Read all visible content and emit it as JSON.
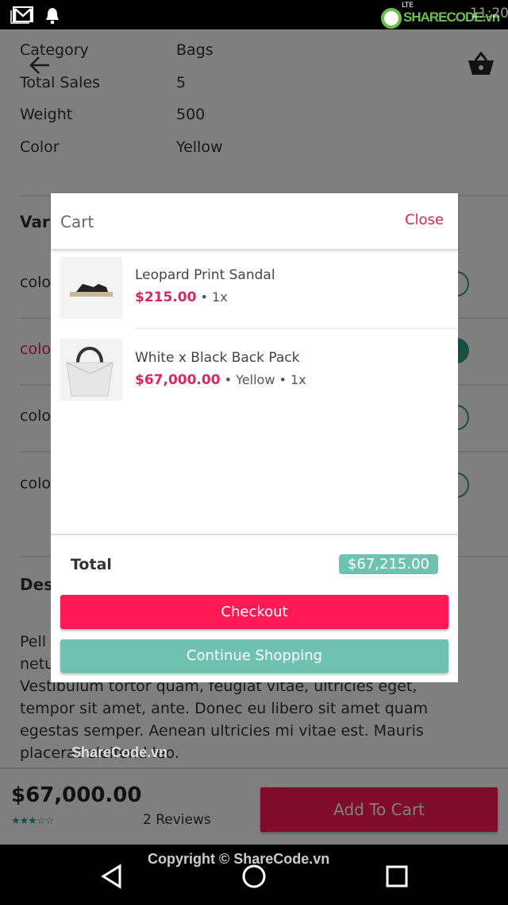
{
  "status_bar": {
    "time": "11:20",
    "network": "LTE",
    "icons": [
      "gmail-icon",
      "bell-icon",
      "signal-icon",
      "battery-icon"
    ]
  },
  "watermark": {
    "logo": "SHARECODE.vn",
    "overlay": "ShareCode.vn",
    "copyright": "Copyright © ShareCode.vn"
  },
  "header": {
    "back_icon": "arrow-left-icon",
    "cart_icon": "basket-icon"
  },
  "specs": [
    {
      "label": "Category",
      "value": "Bags"
    },
    {
      "label": "Total Sales",
      "value": "5"
    },
    {
      "label": "Weight",
      "value": "500"
    },
    {
      "label": "Color",
      "value": "Yellow"
    }
  ],
  "variants": {
    "title": "Variants",
    "items": [
      {
        "label": "color",
        "selected": false
      },
      {
        "label": "color",
        "selected": true
      },
      {
        "label": "color",
        "selected": false
      },
      {
        "label": "color",
        "selected": false
      }
    ]
  },
  "description": {
    "title": "Description",
    "lines": [
      "Pell",
      "netu",
      "Vestibulum tortor quam, feugiat vitae, ultricies eget,",
      "tempor sit amet, ante. Donec eu libero sit amet quam",
      "egestas semper. Aenean ultricies mi vitae est. Mauris",
      "placerat eleifend leo."
    ]
  },
  "bottom_bar": {
    "price": "$67,000.00",
    "rating": 3,
    "rating_max": 5,
    "reviews": "2 Reviews",
    "add_to_cart": "Add To Cart"
  },
  "cart": {
    "title": "Cart",
    "close": "Close",
    "items": [
      {
        "name": "Leopard Print Sandal",
        "price": "$215.00",
        "meta": " • 1x"
      },
      {
        "name": "White x Black Back Pack",
        "price": "$67,000.00",
        "meta": " • Yellow • 1x"
      }
    ],
    "total_label": "Total",
    "total": "$67,215.00",
    "checkout": "Checkout",
    "continue": "Continue Shopping"
  },
  "colors": {
    "accent": "#ff1a55",
    "teal": "#6fc1b2",
    "price": "#e0245e"
  }
}
